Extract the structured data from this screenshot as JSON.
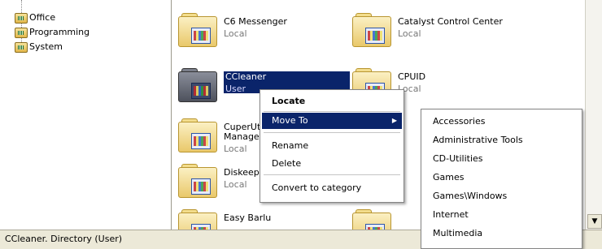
{
  "tree": {
    "items": [
      "Office",
      "Programming",
      "System"
    ]
  },
  "items": [
    {
      "name": "C6 Messenger",
      "type": "Local"
    },
    {
      "name": "Catalyst Control Center",
      "type": "Local"
    },
    {
      "name": "CCleaner",
      "type": "User"
    },
    {
      "name": "CPUID",
      "type": "Local"
    },
    {
      "name": "CuperUti",
      "name2": "Manager",
      "type": "Local"
    },
    {
      "name": "Diskeepe",
      "type": "Local"
    },
    {
      "name": "Easy Barlu",
      "type": ""
    }
  ],
  "context_menu": {
    "items": [
      "Locate",
      "Move To",
      "Rename",
      "Delete",
      "Convert to category"
    ]
  },
  "submenu": {
    "items": [
      "Accessories",
      "Administrative Tools",
      "CD-Utilities",
      "Games",
      "Games\\Windows",
      "Internet",
      "Multimedia"
    ]
  },
  "status": {
    "text": "CCleaner. Directory (User)"
  },
  "colors": {
    "selection": "#0a246a",
    "menu_highlight": "#0a246a"
  }
}
